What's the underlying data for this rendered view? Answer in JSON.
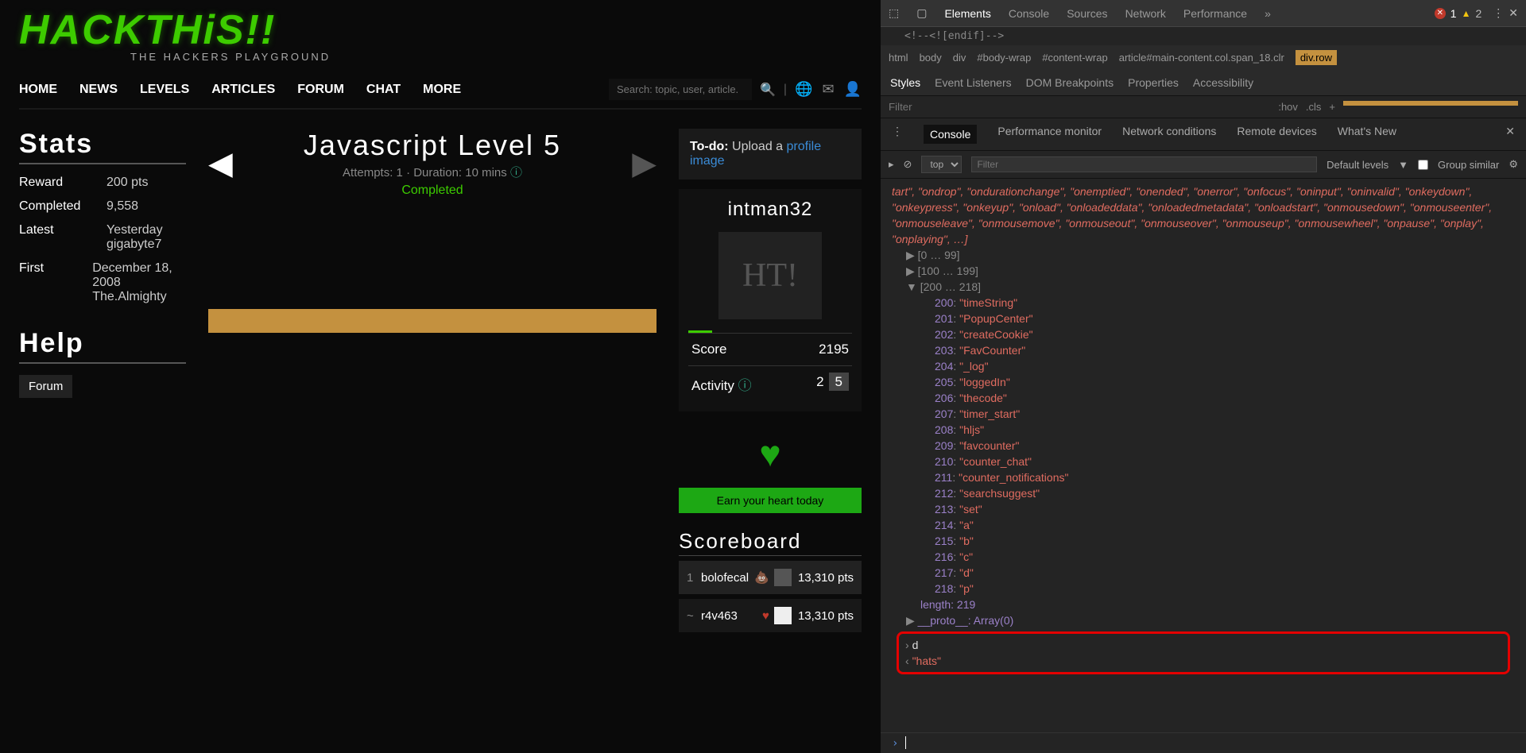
{
  "logo": "HACKTHiS!!",
  "tagline": "THE HACKERS PLAYGROUND",
  "nav": [
    "HOME",
    "NEWS",
    "LEVELS",
    "ARTICLES",
    "FORUM",
    "CHAT",
    "MORE"
  ],
  "search_placeholder": "Search: topic, user, article.",
  "stats": {
    "title": "Stats",
    "rows": [
      {
        "k": "Reward",
        "v": "200 pts"
      },
      {
        "k": "Completed",
        "v": "9,558"
      },
      {
        "k": "Latest",
        "v": "Yesterday\ngigabyte7"
      },
      {
        "k": "First",
        "v": "December 18, 2008\nThe.Almighty"
      }
    ]
  },
  "help": {
    "title": "Help",
    "forum": "Forum"
  },
  "level": {
    "title": "Javascript Level 5",
    "sub": "Attempts: 1 · Duration: 10 mins",
    "status": "Completed"
  },
  "todo": {
    "label": "To-do:",
    "text": "Upload a ",
    "link": "profile image"
  },
  "user": {
    "name": "intman32",
    "avatar": "HT!",
    "score_k": "Score",
    "score_v": "2195",
    "act_k": "Activity",
    "act_a": "2",
    "act_b": "5"
  },
  "earn": "Earn your heart today",
  "scoreboard": {
    "title": "Scoreboard",
    "rows": [
      {
        "rank": "1",
        "name": "bolofecal",
        "pts": "13,310 pts",
        "heart": false
      },
      {
        "rank": "~",
        "name": "r4v463",
        "pts": "13,310 pts",
        "heart": true
      }
    ]
  },
  "devtools": {
    "tabs": [
      "Elements",
      "Console",
      "Sources",
      "Network",
      "Performance"
    ],
    "errors": "1",
    "warnings": "2",
    "html_line": "<!--<![endif]-->",
    "breadcrumb": [
      "html",
      "body",
      "div",
      "#body-wrap",
      "#content-wrap",
      "article#main-content.col.span_18.clr",
      "div.row"
    ],
    "subtabs": [
      "Styles",
      "Event Listeners",
      "DOM Breakpoints",
      "Properties",
      "Accessibility"
    ],
    "filter_ph": "Filter",
    "hov": ":hov",
    "cls": ".cls",
    "drawer": [
      "Console",
      "Performance monitor",
      "Network conditions",
      "Remote devices",
      "What's New"
    ],
    "context": "top",
    "filter2": "Filter",
    "levels": "Default levels",
    "group": "Group similar",
    "redtext": "tart\", \"ondrop\", \"ondurationchange\", \"onemptied\", \"onended\", \"onerror\", \"onfocus\", \"oninput\", \"oninvalid\", \"onkeydown\", \"onkeypress\", \"onkeyup\", \"onload\", \"onloadeddata\", \"onloadedmetadata\", \"onloadstart\", \"onmousedown\", \"onmouseenter\", \"onmouseleave\", \"onmousemove\", \"onmouseout\", \"onmouseover\", \"onmouseup\", \"onmousewheel\", \"onpause\", \"onplay\", \"onplaying\", …]",
    "ranges": [
      "[0 … 99]",
      "[100 … 199]",
      "[200 … 218]"
    ],
    "entries": [
      {
        "i": "200",
        "v": "\"timeString\""
      },
      {
        "i": "201",
        "v": "\"PopupCenter\""
      },
      {
        "i": "202",
        "v": "\"createCookie\""
      },
      {
        "i": "203",
        "v": "\"FavCounter\""
      },
      {
        "i": "204",
        "v": "\"_log\""
      },
      {
        "i": "205",
        "v": "\"loggedIn\""
      },
      {
        "i": "206",
        "v": "\"thecode\""
      },
      {
        "i": "207",
        "v": "\"timer_start\""
      },
      {
        "i": "208",
        "v": "\"hljs\""
      },
      {
        "i": "209",
        "v": "\"favcounter\""
      },
      {
        "i": "210",
        "v": "\"counter_chat\""
      },
      {
        "i": "211",
        "v": "\"counter_notifications\""
      },
      {
        "i": "212",
        "v": "\"searchsuggest\""
      },
      {
        "i": "213",
        "v": "\"set\""
      },
      {
        "i": "214",
        "v": "\"a\""
      },
      {
        "i": "215",
        "v": "\"b\""
      },
      {
        "i": "216",
        "v": "\"c\""
      },
      {
        "i": "217",
        "v": "\"d\""
      },
      {
        "i": "218",
        "v": "\"p\""
      }
    ],
    "length": "length: 219",
    "proto": "__proto__: Array(0)",
    "input_cmd": "d",
    "input_res": "\"hats\""
  }
}
